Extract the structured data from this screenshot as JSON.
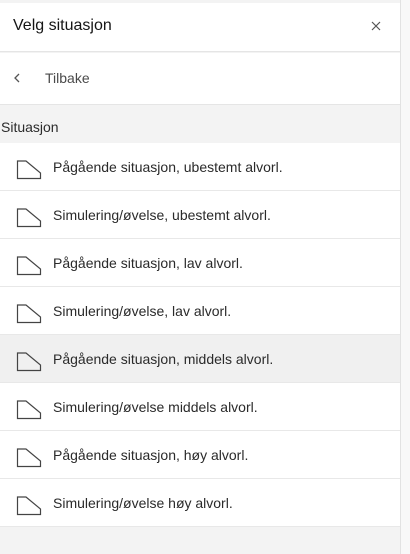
{
  "header": {
    "title": "Velg situasjon",
    "close_icon": "close-icon"
  },
  "back": {
    "label": "Tilbake",
    "icon": "chevron-left-icon"
  },
  "section": {
    "title": "Situasjon"
  },
  "items": [
    {
      "label": "Pågående situasjon, ubestemt alvorl.",
      "icon": "polygon-icon"
    },
    {
      "label": "Simulering/øvelse, ubestemt alvorl.",
      "icon": "polygon-icon"
    },
    {
      "label": "Pågående situasjon, lav alvorl.",
      "icon": "polygon-icon"
    },
    {
      "label": "Simulering/øvelse, lav alvorl.",
      "icon": "polygon-icon"
    },
    {
      "label": "Pågående situasjon, middels alvorl.",
      "icon": "polygon-icon"
    },
    {
      "label": "Simulering/øvelse middels alvorl.",
      "icon": "polygon-icon"
    },
    {
      "label": "Pågående situasjon, høy alvorl.",
      "icon": "polygon-icon"
    },
    {
      "label": "Simulering/øvelse høy alvorl.",
      "icon": "polygon-icon"
    }
  ],
  "colors": {
    "background": "#f3f3f3",
    "surface": "#ffffff",
    "hover": "#f0f0f0",
    "text": "#2a2a2a",
    "divider": "#e8e8e8"
  }
}
